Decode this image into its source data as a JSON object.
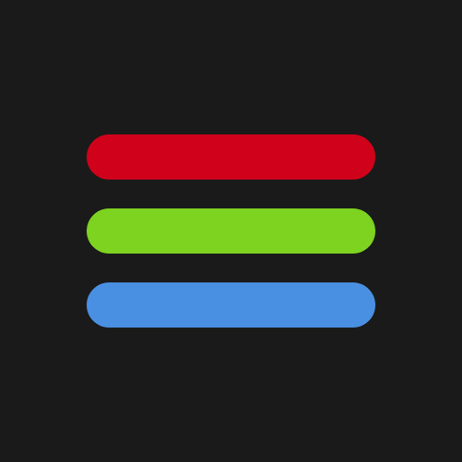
{
  "icon": {
    "name": "hamburger-menu-icon",
    "background_color": "#1a1a1a",
    "bars": [
      {
        "name": "red",
        "color": "#d0021b"
      },
      {
        "name": "green",
        "color": "#7ed321"
      },
      {
        "name": "blue",
        "color": "#4a90e2"
      }
    ]
  }
}
